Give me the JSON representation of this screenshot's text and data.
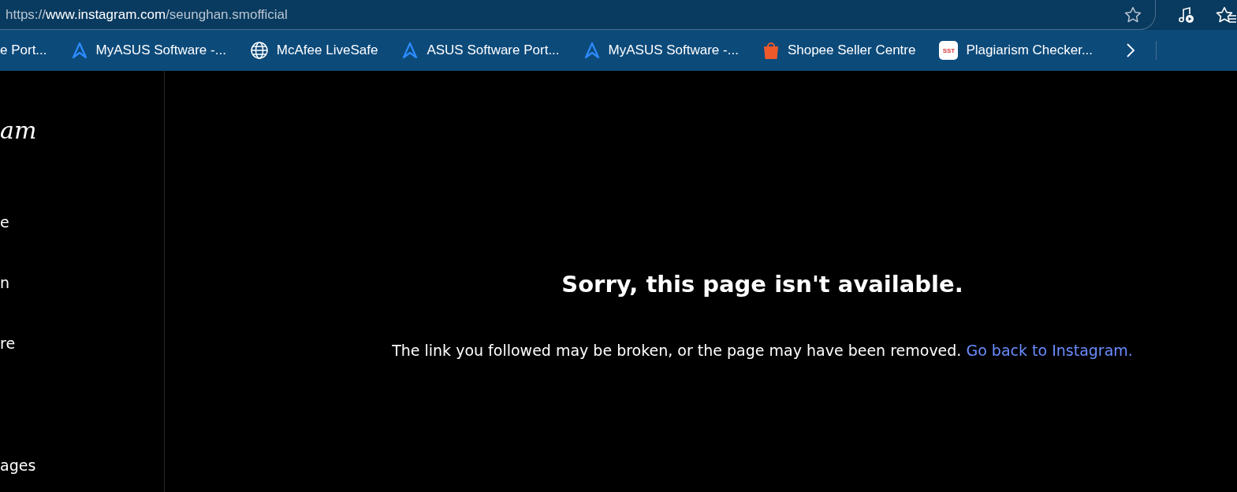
{
  "address_bar": {
    "scheme": "https://",
    "host": "www.instagram.com",
    "path": "/seunghan.smofficial"
  },
  "bookmarks": [
    {
      "label": "e Port...",
      "kind": "none"
    },
    {
      "label": "MyASUS Software -...",
      "kind": "asus"
    },
    {
      "label": "McAfee LiveSafe",
      "kind": "globe"
    },
    {
      "label": "ASUS Software Port...",
      "kind": "asus"
    },
    {
      "label": "MyASUS Software -...",
      "kind": "asus"
    },
    {
      "label": "Shopee Seller Centre",
      "kind": "shopee"
    },
    {
      "label": "Plagiarism Checker...",
      "kind": "sst",
      "icon_text": "SST"
    }
  ],
  "sidebar": {
    "logo": "am",
    "items": [
      "e",
      "n",
      "re",
      "ages"
    ]
  },
  "error": {
    "title": "Sorry, this page isn't available.",
    "message": "The link you followed may be broken, or the page may have been removed.",
    "link": "Go back to Instagram."
  }
}
